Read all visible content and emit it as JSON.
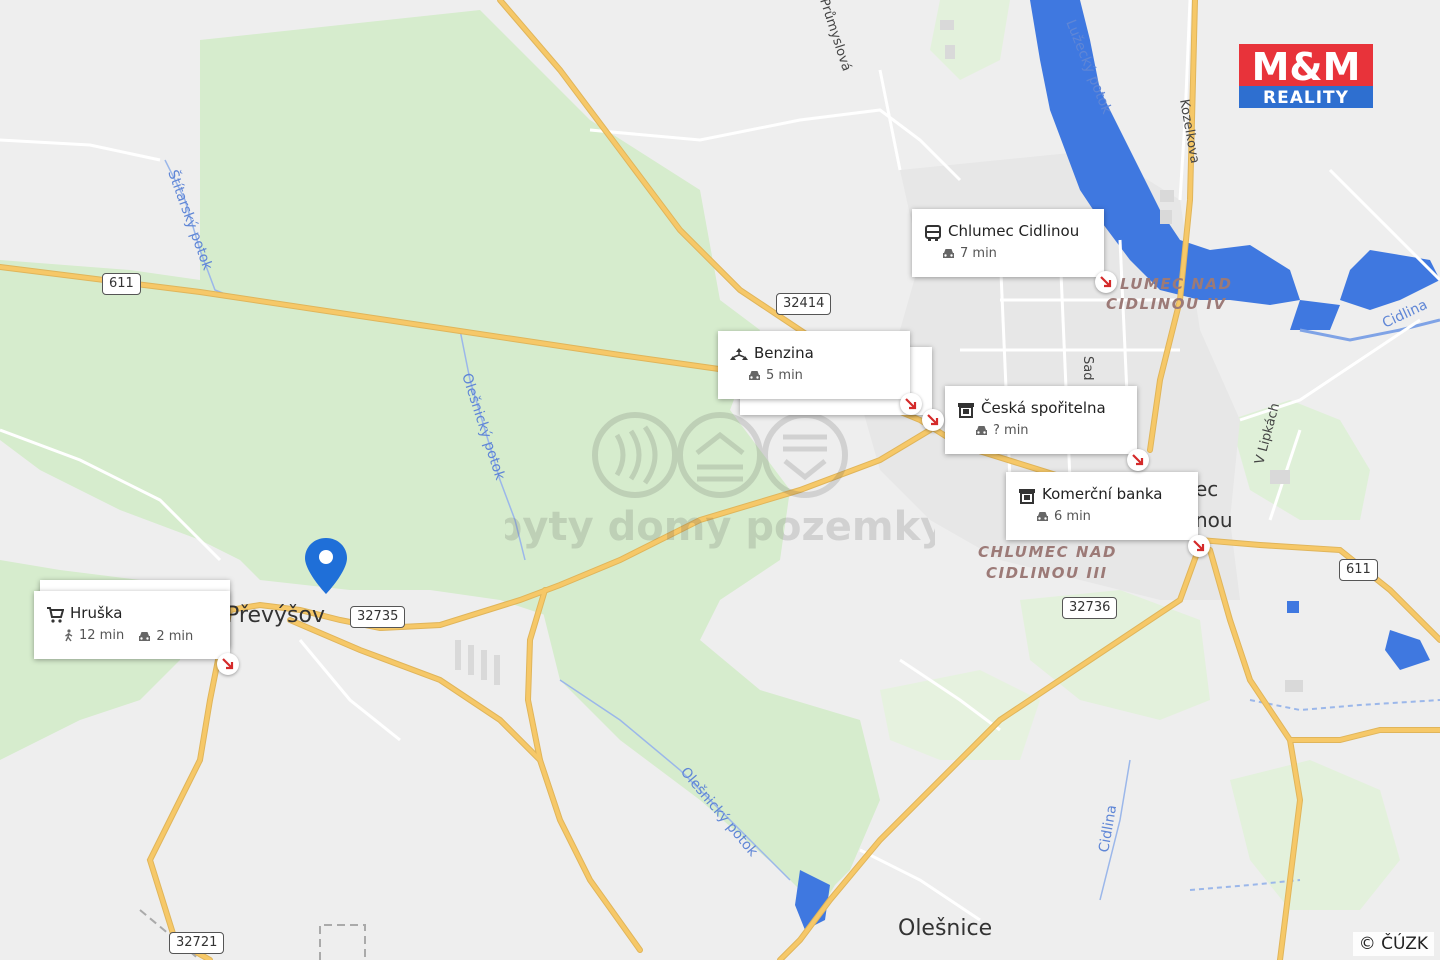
{
  "map": {
    "places": {
      "prevysov": "Převýšov",
      "olesnice": "Olešnice",
      "chlumec_partial_1": "ec",
      "chlumec_partial_2": "nou"
    },
    "districts": {
      "chlumec_iv_line1": "LUMEC NAD",
      "chlumec_iv_line2": "CIDLINOU IV",
      "chlumec_iii_line1": "CHLUMEC NAD",
      "chlumec_iii_line2": "CIDLINOU III"
    },
    "roads": [
      "611",
      "32414",
      "32735",
      "32736",
      "611",
      "32721"
    ],
    "streams": {
      "stritarsky": "Štítarský potok",
      "olesnicky_1": "Olešnický potok",
      "olesnicky_2": "Olešnický potok",
      "luzecky": "Lužecký potok",
      "cidlina_1": "Cidlina",
      "cidlina_2": "Cidlina"
    },
    "streets": {
      "prumyslova": "Průmyslová",
      "kozelkova": "Kozelkova",
      "v_lipkach": "V Lipkách",
      "sad": "Sad"
    },
    "colors": {
      "forest": "#d6eccd",
      "water": "#3f78e0",
      "road": "#f6c868",
      "background": "#eeeeee",
      "pin": "#1f6fd8",
      "arrow": "#d42a2a"
    }
  },
  "pois": [
    {
      "name": "Chlumec Cidlinou",
      "icon": "bus-icon",
      "drive": "7 min"
    },
    {
      "name": "Benzina",
      "icon": "gas-station-icon",
      "drive": "5 min"
    },
    {
      "name": "Česká spořitelna",
      "icon": "atm-icon",
      "drive": "? min"
    },
    {
      "name": "Komerční banka",
      "icon": "atm-icon",
      "drive": "6 min"
    },
    {
      "name": "Hruška",
      "icon": "shopping-cart-icon",
      "walk": "12 min",
      "drive": "2 min"
    }
  ],
  "logo": {
    "top": "M&M",
    "bottom": "REALITY",
    "colors": {
      "top": "#e8333a",
      "bottom": "#2e6fd0"
    }
  },
  "watermark": "byty domy pozemky",
  "copyright": "© ČÚZK"
}
